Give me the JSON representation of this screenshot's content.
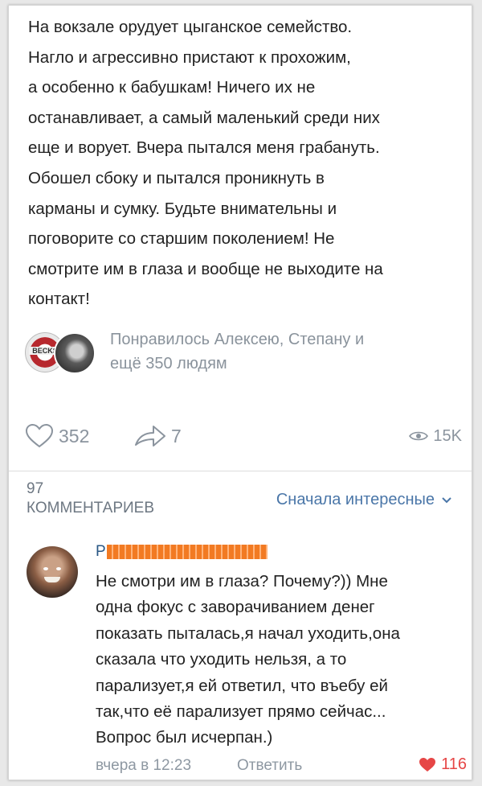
{
  "post": {
    "lines": [
      "На вокзале орудует цыганское семейство.",
      "Нагло и агрессивно пристают к прохожим,",
      "а особенно к бабушкам! Ничего их не",
      "останавливает, а самый маленький среди них",
      "еще и ворует. Вчера пытался меня грабануть.",
      "Обошел сбоку и пытался проникнуть в",
      "карманы и сумку. Будьте внимательны и",
      "поговорите со старшим поколением! Не",
      "смотрите им в глаза и вообще не выходите на",
      "контакт!"
    ]
  },
  "likes": {
    "avatar1_text": "BECKS",
    "text_line1": "Понравилось Алексею, Степану и",
    "text_line2": "ещё 350 людям"
  },
  "stats": {
    "likes": "352",
    "shares": "7",
    "views": "15K"
  },
  "comments": {
    "count": "97",
    "label": "КОММЕНТАРИЕВ",
    "sort_label": "Сначала интересные"
  },
  "comment": {
    "author_initial": "Р",
    "lines": [
      "Не смотри им в глаза? Почему?)) Мне",
      "одна фокус с заворачиванием денег",
      "показать пыталась,я начал уходить,она",
      "сказала что уходить нельзя, а то",
      "парализует,я ей ответил, что въебу ей",
      "так,что её парализует прямо сейчас...",
      "Вопрос был исчерпан.)"
    ],
    "time": "вчера в 12:23",
    "reply": "Ответить",
    "likes": "116"
  },
  "colors": {
    "link": "#4a76a8",
    "muted": "#8b949e",
    "like_red": "#e64646",
    "redaction": "#f27a22"
  }
}
